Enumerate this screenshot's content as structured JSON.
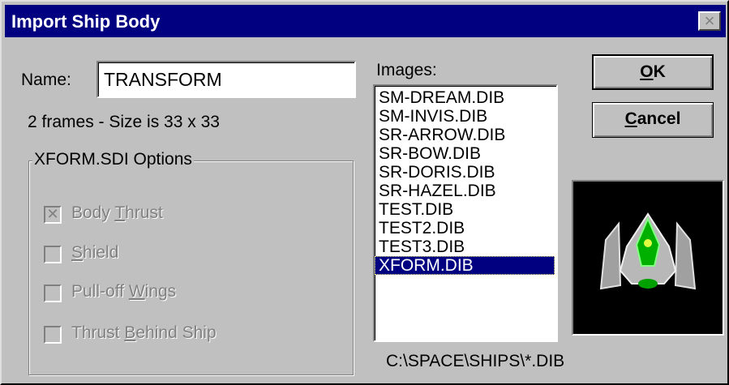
{
  "window": {
    "title": "Import Ship Body",
    "close_glyph": "×"
  },
  "name_field": {
    "label": "Name:",
    "value": "TRANSFORM"
  },
  "frames_info": "2 frames  -  Size is 33 x 33",
  "options": {
    "legend": "XFORM.SDI Options",
    "items": [
      {
        "pre": "Body ",
        "mnemonic": "T",
        "post": "hrust",
        "checked": true,
        "enabled": false
      },
      {
        "pre": "",
        "mnemonic": "S",
        "post": "hield",
        "checked": false,
        "enabled": false
      },
      {
        "pre": "Pull-off ",
        "mnemonic": "W",
        "post": "ings",
        "checked": false,
        "enabled": false
      },
      {
        "pre": "Thrust ",
        "mnemonic": "B",
        "post": "ehind Ship",
        "checked": false,
        "enabled": false
      }
    ]
  },
  "images": {
    "label": "Images:",
    "items": [
      "SM-DREAM.DIB",
      "SM-INVIS.DIB",
      "SR-ARROW.DIB",
      "SR-BOW.DIB",
      "SR-DORIS.DIB",
      "SR-HAZEL.DIB",
      "TEST.DIB",
      "TEST2.DIB",
      "TEST3.DIB",
      "XFORM.DIB"
    ],
    "selected": "XFORM.DIB"
  },
  "path": "C:\\SPACE\\SHIPS\\*.DIB",
  "buttons": {
    "ok": {
      "mnemonic": "O",
      "rest": "K"
    },
    "cancel": {
      "mnemonic": "C",
      "rest": "ancel"
    }
  },
  "colors": {
    "titlebar": "#000080",
    "face": "#c0c0c0",
    "selection": "#000080",
    "ship_body": "#00c000"
  }
}
